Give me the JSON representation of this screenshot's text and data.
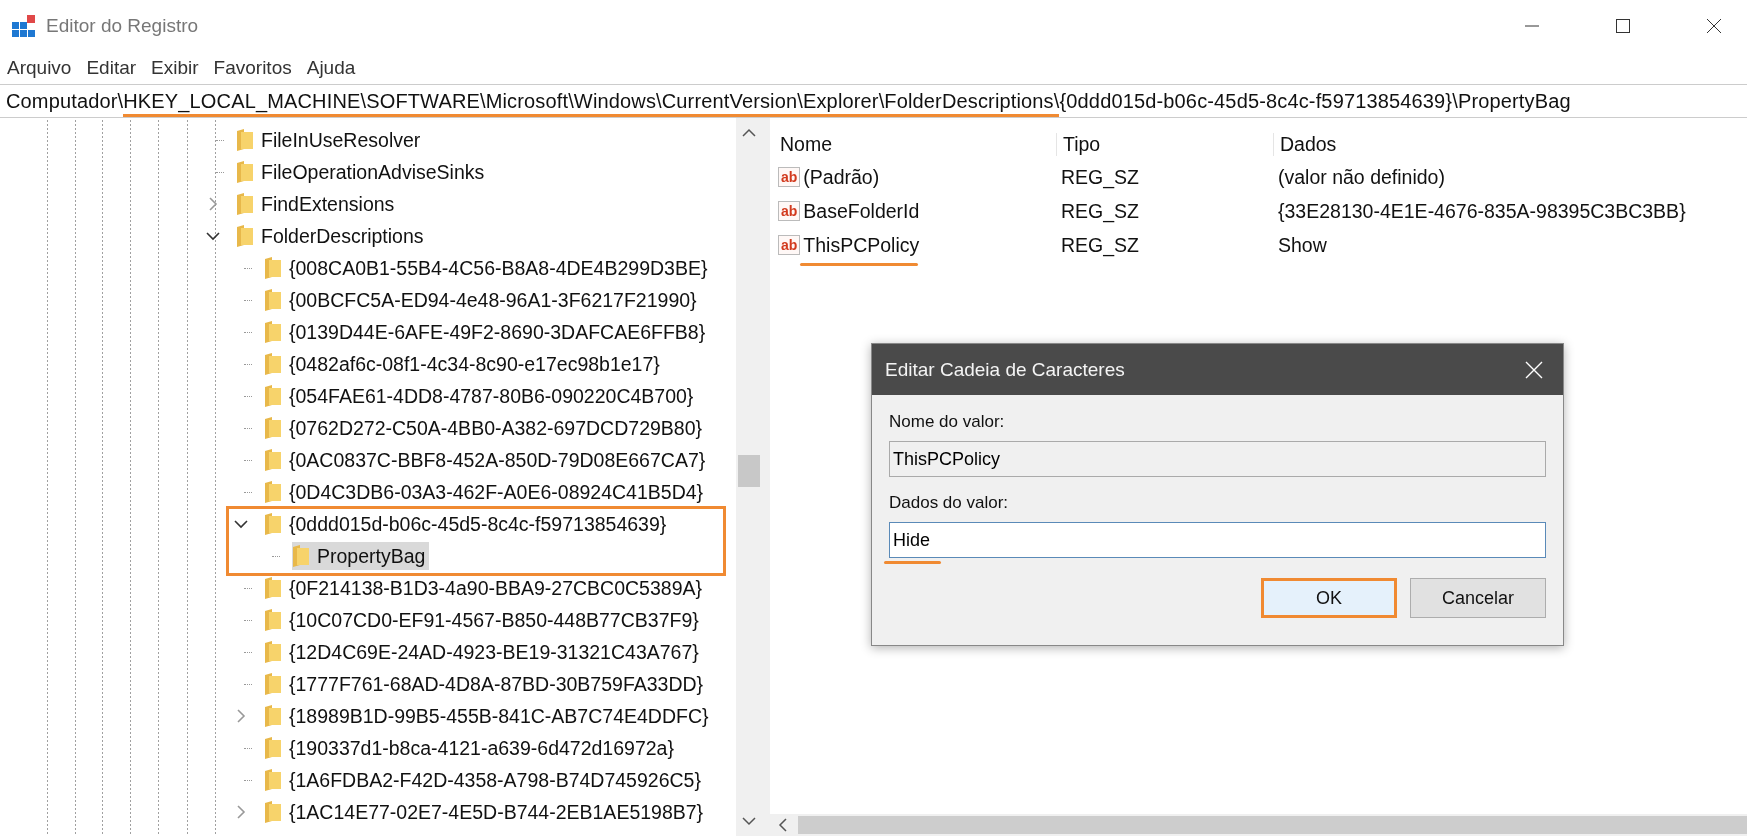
{
  "window": {
    "title": "Editor do Registro"
  },
  "menu": [
    "Arquivo",
    "Editar",
    "Exibir",
    "Favoritos",
    "Ajuda"
  ],
  "address": [
    {
      "text": "Computador\\",
      "marked": false
    },
    {
      "text": "HKEY_LOCAL_MACHINE\\SOFTWARE\\Microsoft\\Windows\\CurrentVersion\\Explorer\\FolderDescriptions\\",
      "marked": true
    },
    {
      "text": "{0ddd015d-b06c-45d5-8c4c-f59713854639}\\PropertyBag",
      "marked": false
    }
  ],
  "tree": {
    "items": [
      {
        "label": "FileInUseResolver",
        "expandable": false,
        "selected": false,
        "marked": false
      },
      {
        "label": "FileOperationAdviseSinks",
        "expandable": false,
        "selected": false,
        "marked": false
      },
      {
        "label": "FindExtensions",
        "expandable": true,
        "expanded": false,
        "selected": false,
        "marked": false
      },
      {
        "label": "FolderDescriptions",
        "expandable": true,
        "expanded": true,
        "selected": false,
        "marked": false,
        "children": [
          {
            "label": "{008CA0B1-55B4-4C56-B8A8-4DE4B299D3BE}",
            "expandable": false,
            "selected": false,
            "marked": false
          },
          {
            "label": "{00BCFC5A-ED94-4e48-96A1-3F6217F21990}",
            "expandable": false,
            "selected": false,
            "marked": false
          },
          {
            "label": "{0139D44E-6AFE-49F2-8690-3DAFCAE6FFB8}",
            "expandable": false,
            "selected": false,
            "marked": false
          },
          {
            "label": "{0482af6c-08f1-4c34-8c90-e17ec98b1e17}",
            "expandable": false,
            "selected": false,
            "marked": false
          },
          {
            "label": "{054FAE61-4DD8-4787-80B6-090220C4B700}",
            "expandable": false,
            "selected": false,
            "marked": false
          },
          {
            "label": "{0762D272-C50A-4BB0-A382-697DCD729B80}",
            "expandable": false,
            "selected": false,
            "marked": false
          },
          {
            "label": "{0AC0837C-BBF8-452A-850D-79D08E667CA7}",
            "expandable": false,
            "selected": false,
            "marked": false
          },
          {
            "label": "{0D4C3DB6-03A3-462F-A0E6-08924C41B5D4}",
            "expandable": false,
            "selected": false,
            "marked": false
          },
          {
            "label": "{0ddd015d-b06c-45d5-8c4c-f59713854639}",
            "expandable": true,
            "expanded": true,
            "selected": false,
            "marked": true,
            "children": [
              {
                "label": "PropertyBag",
                "expandable": false,
                "selected": true,
                "marked": false
              }
            ]
          },
          {
            "label": "{0F214138-B1D3-4a90-BBA9-27CBC0C5389A}",
            "expandable": false,
            "selected": false,
            "marked": false
          },
          {
            "label": "{10C07CD0-EF91-4567-B850-448B77CB37F9}",
            "expandable": false,
            "selected": false,
            "marked": false
          },
          {
            "label": "{12D4C69E-24AD-4923-BE19-31321C43A767}",
            "expandable": false,
            "selected": false,
            "marked": false
          },
          {
            "label": "{1777F761-68AD-4D8A-87BD-30B759FA33DD}",
            "expandable": false,
            "selected": false,
            "marked": false
          },
          {
            "label": "{18989B1D-99B5-455B-841C-AB7C74E4DDFC}",
            "expandable": true,
            "expanded": false,
            "selected": false,
            "marked": false
          },
          {
            "label": "{190337d1-b8ca-4121-a639-6d472d16972a}",
            "expandable": false,
            "selected": false,
            "marked": false
          },
          {
            "label": "{1A6FDBA2-F42D-4358-A798-B74D745926C5}",
            "expandable": false,
            "selected": false,
            "marked": false
          },
          {
            "label": "{1AC14E77-02E7-4E5D-B744-2EB1AE5198B7}",
            "expandable": true,
            "expanded": false,
            "selected": false,
            "marked": false
          }
        ]
      }
    ]
  },
  "values": {
    "columns": [
      "Nome",
      "Tipo",
      "Dados"
    ],
    "rows": [
      {
        "icon": "ab",
        "name": "(Padrão)",
        "type": "REG_SZ",
        "data": "(valor não definido)",
        "marked": false
      },
      {
        "icon": "ab",
        "name": "BaseFolderId",
        "type": "REG_SZ",
        "data": "{33E28130-4E1E-4676-835A-98395C3BC3BB}",
        "marked": false
      },
      {
        "icon": "ab",
        "name": "ThisPCPolicy",
        "type": "REG_SZ",
        "data": "Show",
        "marked": true
      }
    ]
  },
  "dialog": {
    "title": "Editar Cadeia de Caracteres",
    "name_label": "Nome do valor:",
    "name_value": "ThisPCPolicy",
    "data_label": "Dados do valor:",
    "data_value": "Hide",
    "data_marked": true,
    "buttons": [
      {
        "label": "OK",
        "default": true,
        "marked": true
      },
      {
        "label": "Cancelar",
        "default": false,
        "marked": false
      }
    ]
  }
}
